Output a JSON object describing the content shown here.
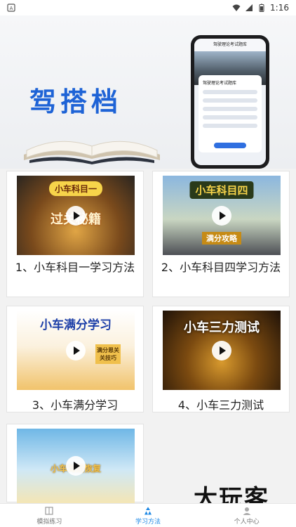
{
  "status_bar": {
    "time": "1:16",
    "left_icon": "a-badge-icon"
  },
  "banner": {
    "title": "驾搭档",
    "phone_title": "驾驶理论考试题库",
    "phone_card_title": "驾驶理论考试题库"
  },
  "cards": [
    {
      "label": "1、小车科目一学习方法",
      "thumb_tag": "小车科目一",
      "thumb_sub": "过关秘籍"
    },
    {
      "label": "2、小车科目四学习方法",
      "thumb_tag": "小车科目四",
      "thumb_sub": "满分攻略"
    },
    {
      "label": "3、小车满分学习",
      "thumb_tag": "小车满分学习",
      "thumb_sub": "满分恩关关技巧"
    },
    {
      "label": "4、小车三力测试",
      "thumb_tag": "小车三力测试"
    },
    {
      "label": "",
      "thumb_tag": "小车驾照恢复"
    }
  ],
  "watermark": "大玩客",
  "bottom_nav": [
    {
      "label": "模拟练习",
      "icon": "book-icon",
      "active": false
    },
    {
      "label": "学习方法",
      "icon": "recycle-icon",
      "active": true
    },
    {
      "label": "个人中心",
      "icon": "person-icon",
      "active": false
    }
  ],
  "colors": {
    "accent": "#1e88e5",
    "banner_title": "#1e63d6"
  }
}
